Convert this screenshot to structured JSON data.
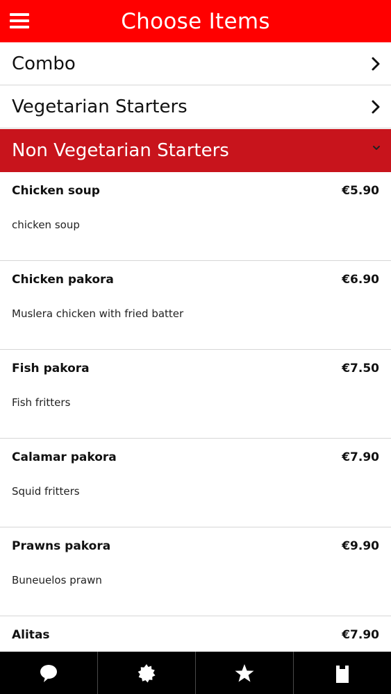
{
  "header": {
    "title": "Choose Items",
    "menu_icon": "hamburger-menu-icon"
  },
  "categories": [
    {
      "label": "Combo",
      "state": "collapsed",
      "icon": "chevron-right-icon"
    },
    {
      "label": "Vegetarian Starters",
      "state": "collapsed",
      "icon": "chevron-right-icon"
    },
    {
      "label": "Non Vegetarian Starters",
      "state": "expanded",
      "icon": "chevron-down-icon"
    }
  ],
  "items": [
    {
      "name": "Chicken soup",
      "price": "€5.90",
      "description": "chicken soup"
    },
    {
      "name": "Chicken pakora",
      "price": "€6.90",
      "description": "Muslera chicken with fried batter"
    },
    {
      "name": "Fish pakora",
      "price": "€7.50",
      "description": "Fish fritters"
    },
    {
      "name": "Calamar pakora",
      "price": "€7.90",
      "description": "Squid fritters"
    },
    {
      "name": "Prawns pakora",
      "price": "€9.90",
      "description": "Buneuelos prawn"
    },
    {
      "name": "Alitas",
      "price": "€7.90",
      "description": ""
    }
  ],
  "bottom_nav": [
    {
      "icon": "chat-bubble-icon"
    },
    {
      "icon": "badge-icon"
    },
    {
      "icon": "star-icon"
    },
    {
      "icon": "bag-icon"
    }
  ],
  "colors": {
    "header_bg": "#ff0000",
    "active_category_bg": "#c8141c",
    "bottom_nav_bg": "#000000"
  }
}
